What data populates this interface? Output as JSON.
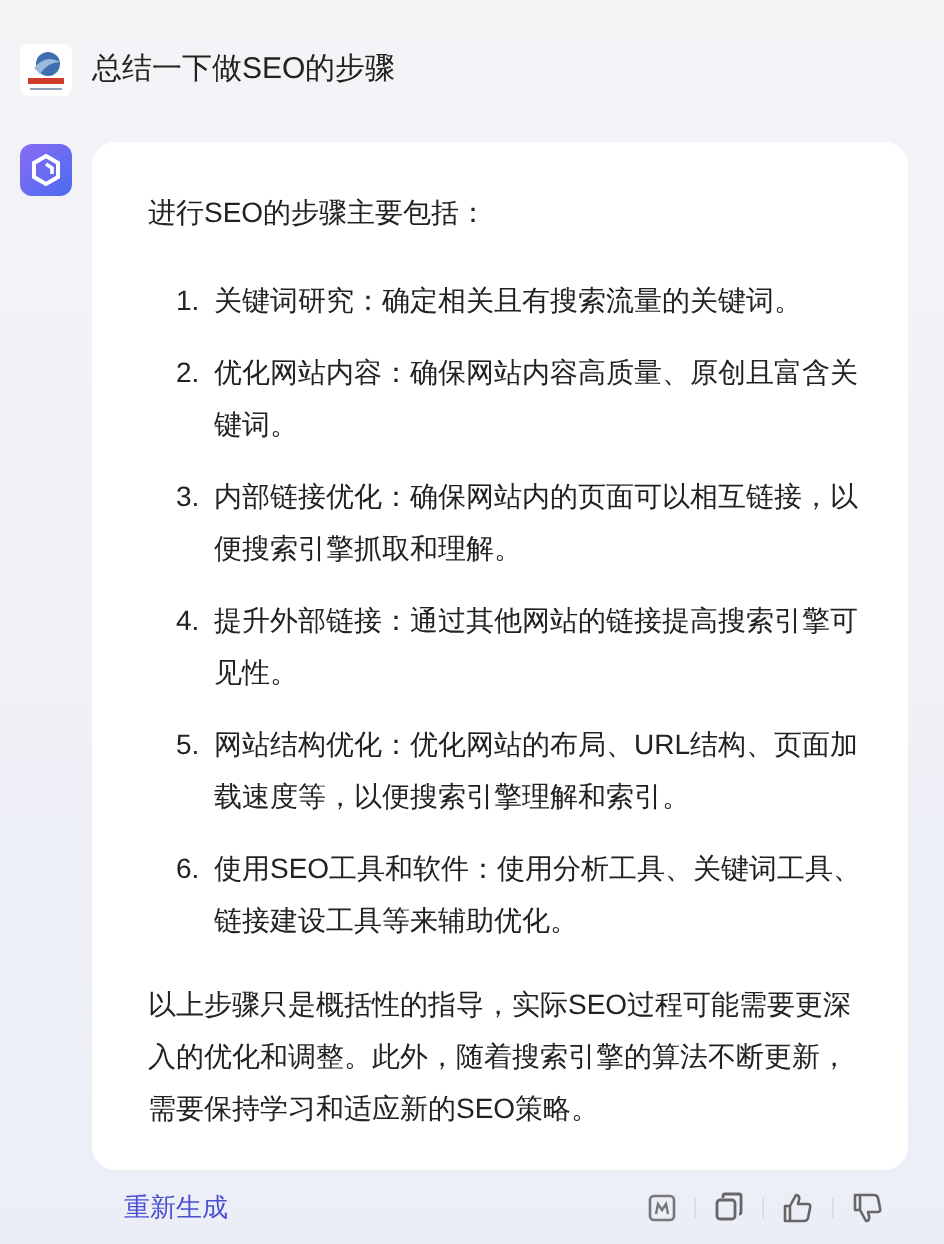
{
  "user_message": {
    "text": "总结一下做SEO的步骤"
  },
  "answer": {
    "intro": "进行SEO的步骤主要包括：",
    "steps": [
      {
        "number": "1.",
        "text": "关键词研究：确定相关且有搜索流量的关键词。"
      },
      {
        "number": "2.",
        "text": "优化网站内容：确保网站内容高质量、原创且富含关键词。"
      },
      {
        "number": "3.",
        "text": "内部链接优化：确保网站内的页面可以相互链接，以便搜索引擎抓取和理解。"
      },
      {
        "number": "4.",
        "text": "提升外部链接：通过其他网站的链接提高搜索引擎可见性。"
      },
      {
        "number": "5.",
        "text": "网站结构优化：优化网站的布局、URL结构、页面加载速度等，以便搜索引擎理解和索引。"
      },
      {
        "number": "6.",
        "text": "使用SEO工具和软件：使用分析工具、关键词工具、链接建设工具等来辅助优化。"
      }
    ],
    "conclusion": "以上步骤只是概括性的指导，实际SEO过程可能需要更深入的优化和调整。此外，随着搜索引擎的算法不断更新，需要保持学习和适应新的SEO策略。"
  },
  "actions": {
    "regenerate": "重新生成"
  }
}
